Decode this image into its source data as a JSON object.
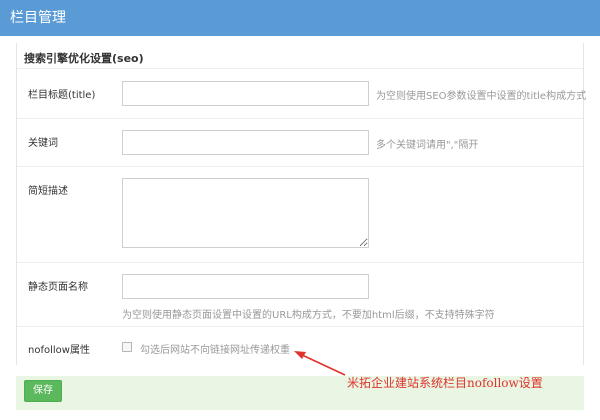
{
  "header": {
    "title": "栏目管理"
  },
  "section": {
    "title": "搜索引擎优化设置(seo)"
  },
  "fields": {
    "title": {
      "label": "栏目标题(title)",
      "value": "",
      "hint": "为空则使用SEO参数设置中设置的title构成方式"
    },
    "keywords": {
      "label": "关键词",
      "value": "",
      "hint": "多个关键词请用\",\"隔开"
    },
    "description": {
      "label": "简短描述",
      "value": ""
    },
    "static_page": {
      "label": "静态页面名称",
      "value": "",
      "hint": "为空则使用静态页面设置中设置的URL构成方式，不要加html后缀，不支持特殊字符"
    },
    "nofollow": {
      "label": "nofollow属性",
      "checkbox_label": "勾选后网站不向链接网址传递权重",
      "checked": false
    }
  },
  "footer": {
    "save_label": "保存"
  },
  "annotation": {
    "text": "米拓企业建站系统栏目nofollow设置",
    "color": "#e0332b"
  },
  "colors": {
    "header": "#5b9bd5",
    "save_button": "#5cb85c",
    "footer_bar": "#e8f6e3"
  }
}
